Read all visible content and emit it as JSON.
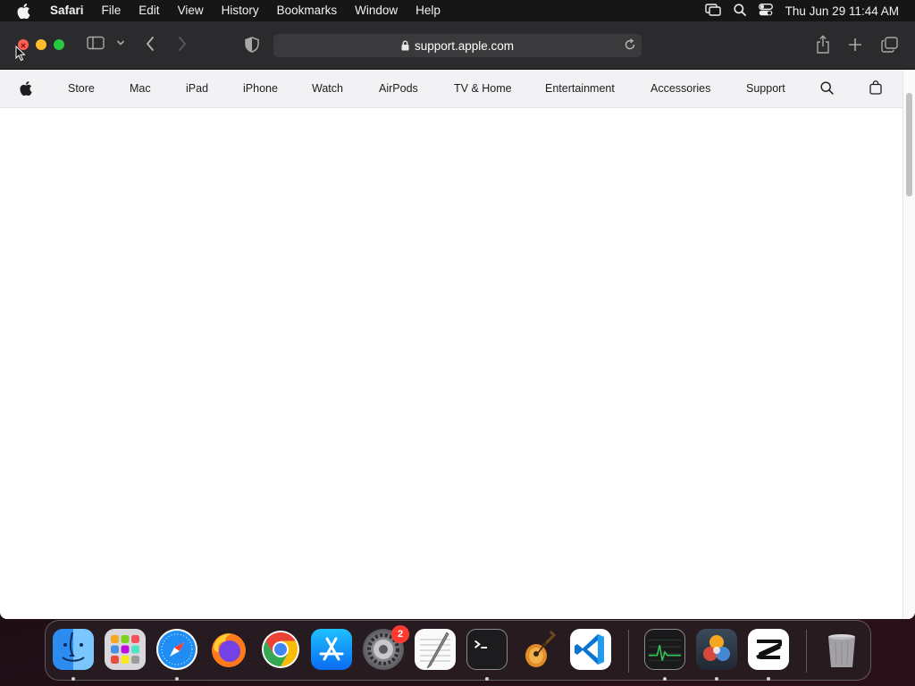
{
  "menubar": {
    "app_name": "Safari",
    "items": [
      "File",
      "Edit",
      "View",
      "History",
      "Bookmarks",
      "Window",
      "Help"
    ],
    "clock": "Thu Jun 29  11:44 AM"
  },
  "browser": {
    "url": "support.apple.com"
  },
  "apple_nav": {
    "items": [
      "Store",
      "Mac",
      "iPad",
      "iPhone",
      "Watch",
      "AirPods",
      "TV & Home",
      "Entertainment",
      "Accessories",
      "Support"
    ]
  },
  "dock": {
    "apps": [
      {
        "name": "Finder",
        "icon": "finder-icon"
      },
      {
        "name": "Launchpad",
        "icon": "launchpad-icon"
      },
      {
        "name": "Safari",
        "icon": "safari-icon"
      },
      {
        "name": "Firefox",
        "icon": "firefox-icon"
      },
      {
        "name": "Chrome",
        "icon": "chrome-icon"
      },
      {
        "name": "App Store",
        "icon": "app-store-icon"
      },
      {
        "name": "System Settings",
        "icon": "system-settings-icon",
        "badge": "2"
      },
      {
        "name": "TextEdit",
        "icon": "textedit-icon"
      },
      {
        "name": "Terminal",
        "icon": "terminal-icon"
      },
      {
        "name": "GarageBand",
        "icon": "garageband-icon"
      },
      {
        "name": "Visual Studio Code",
        "icon": "vscode-icon"
      },
      {
        "name": "Activity Monitor",
        "icon": "activity-monitor-icon"
      },
      {
        "name": "DaVinci Resolve",
        "icon": "davinci-resolve-icon"
      },
      {
        "name": "CapCut",
        "icon": "capcut-icon"
      },
      {
        "name": "Trash",
        "icon": "trash-icon"
      }
    ]
  },
  "colors": {
    "traffic_close": "#ff5f57",
    "traffic_minimize": "#febc2e",
    "traffic_maximize": "#28c840",
    "toolbar_bg": "#2b2b2d",
    "nav_bg": "#f2f2f4",
    "badge": "#ff3b30"
  }
}
